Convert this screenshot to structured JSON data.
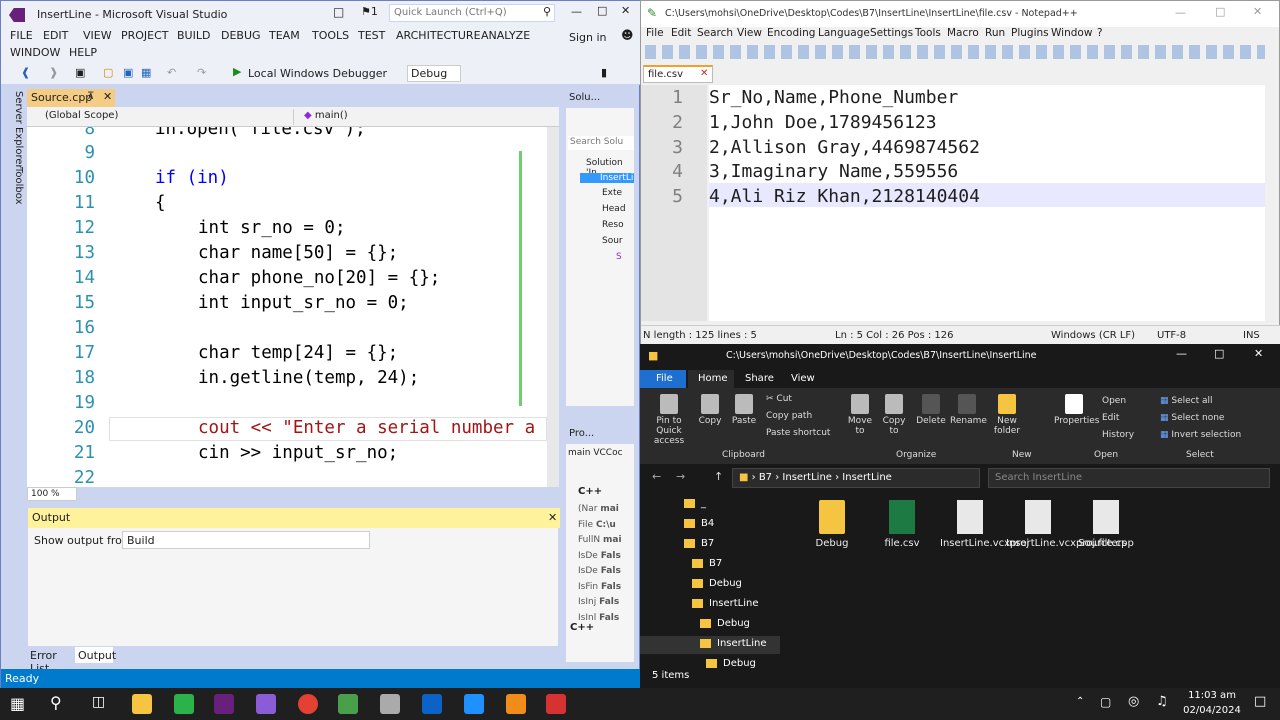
{
  "vs": {
    "title": "InsertLine - Microsoft Visual Studio",
    "notif_count": "1",
    "quick_launch_placeholder": "Quick Launch (Ctrl+Q)",
    "menu": [
      "FILE",
      "EDIT",
      "VIEW",
      "PROJECT",
      "BUILD",
      "DEBUG",
      "TEAM",
      "TOOLS",
      "TEST",
      "ARCHITECTURE",
      "ANALYZE",
      "WINDOW",
      "HELP"
    ],
    "sign_in": "Sign in",
    "debugger": "Local Windows Debugger",
    "config": "Debug",
    "tab": "Source.cpp",
    "scope": "(Global Scope)",
    "func": "main()",
    "zoom": "100 %",
    "side_tabs": [
      "Server Explorer",
      "Toolbox"
    ],
    "code_lines": [
      {
        "n": "8",
        "t": "in.open(\"file.csv\");"
      },
      {
        "n": "9",
        "t": ""
      },
      {
        "n": "10",
        "t": "if (in)"
      },
      {
        "n": "11",
        "t": "{"
      },
      {
        "n": "12",
        "t": "int sr_no = 0;"
      },
      {
        "n": "13",
        "t": "char name[50] = {};"
      },
      {
        "n": "14",
        "t": "char phone_no[20] = {};"
      },
      {
        "n": "15",
        "t": "int input_sr_no = 0;"
      },
      {
        "n": "16",
        "t": ""
      },
      {
        "n": "17",
        "t": "char temp[24] = {};"
      },
      {
        "n": "18",
        "t": "in.getline(temp, 24);"
      },
      {
        "n": "19",
        "t": ""
      },
      {
        "n": "20",
        "t": "cout << \"Enter a serial number a"
      },
      {
        "n": "21",
        "t": "cin >> input_sr_no;"
      },
      {
        "n": "22",
        "t": ""
      }
    ],
    "output_title": "Output",
    "output_from_label": "Show output from:",
    "output_from_value": "Build",
    "bottom_tabs": [
      "Error List",
      "Output"
    ],
    "status": "Ready",
    "sol_title": "Solu...",
    "sol_search": "Search Solu",
    "sol_items": [
      "Solution 'In",
      "InsertLi",
      "Exte",
      "Head",
      "Reso",
      "Sour",
      "S"
    ],
    "prop_title": "Pro...",
    "prop_sub": "main  VCCoc",
    "prop_cat": "C++",
    "prop_rows": [
      [
        "(Nar",
        "mai"
      ],
      [
        "File",
        "C:\\u"
      ],
      [
        "FullN",
        "mai"
      ],
      [
        "IsDe",
        "Fals"
      ],
      [
        "IsDe",
        "Fals"
      ],
      [
        "IsFin",
        "Fals"
      ],
      [
        "IsInj",
        "Fals"
      ],
      [
        "IsInl",
        "Fals"
      ]
    ],
    "prop_footer": "C++"
  },
  "npp": {
    "title": "C:\\Users\\mohsi\\OneDrive\\Desktop\\Codes\\B7\\InsertLine\\InsertLine\\file.csv - Notepad++",
    "menu": [
      "File",
      "Edit",
      "Search",
      "View",
      "Encoding",
      "Language",
      "Settings",
      "Tools",
      "Macro",
      "Run",
      "Plugins",
      "Window",
      "?"
    ],
    "tab": "file.csv",
    "lines": [
      {
        "n": "1",
        "t": "Sr_No,Name,Phone_Number"
      },
      {
        "n": "2",
        "t": "1,John Doe,1789456123"
      },
      {
        "n": "3",
        "t": "2,Allison Gray,4469874562"
      },
      {
        "n": "4",
        "t": "3,Imaginary Name,559556"
      },
      {
        "n": "5",
        "t": "4,Ali Riz Khan,2128140404"
      }
    ],
    "status": {
      "length": "N length : 125    lines : 5",
      "pos": "Ln : 5    Col : 26    Pos : 126",
      "eol": "Windows (CR LF)",
      "enc": "UTF-8",
      "mode": "INS"
    }
  },
  "explorer": {
    "title": "C:\\Users\\mohsi\\OneDrive\\Desktop\\Codes\\B7\\InsertLine\\InsertLine",
    "tabs": [
      "File",
      "Home",
      "Share",
      "View"
    ],
    "ribbon": {
      "pin": "Pin to Quick access",
      "copy": "Copy",
      "paste": "Paste",
      "cut": "Cut",
      "copy_path": "Copy path",
      "paste_shortcut": "Paste shortcut",
      "move": "Move to",
      "copyto": "Copy to",
      "delete": "Delete",
      "rename": "Rename",
      "new_folder": "New folder",
      "properties": "Properties",
      "open": "Open",
      "edit": "Edit",
      "history": "History",
      "select_all": "Select all",
      "select_none": "Select none",
      "invert": "Invert selection",
      "groups": [
        "Clipboard",
        "Organize",
        "New",
        "Open",
        "Select"
      ]
    },
    "address": [
      "B7",
      "InsertLine",
      "InsertLine"
    ],
    "search_placeholder": "Search InsertLine",
    "tree": [
      "_",
      "B4",
      "B7",
      "B7",
      "Debug",
      "InsertLine",
      "Debug",
      "InsertLine",
      "Debug"
    ],
    "files": [
      "Debug",
      "file.csv",
      "InsertLine.vcxproj",
      "InsertLine.vcxproj.filters",
      "Source.cpp"
    ],
    "status": "5 items"
  },
  "taskbar": {
    "time": "11:03 am",
    "date": "02/04/2024"
  }
}
